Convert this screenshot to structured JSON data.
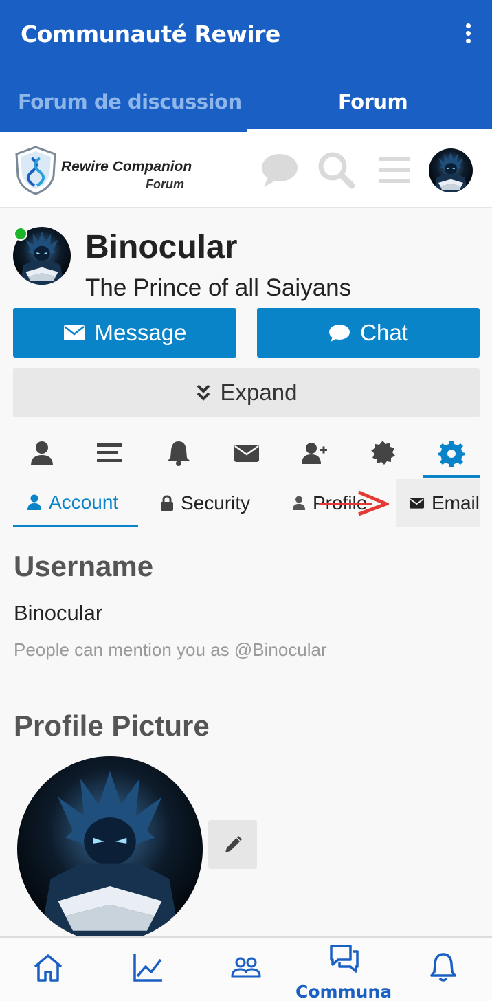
{
  "app_bar": {
    "title": "Communauté Rewire"
  },
  "tabs": [
    {
      "label": "Forum de discussion",
      "active": false
    },
    {
      "label": "Forum",
      "active": true
    }
  ],
  "site_header": {
    "logo_name": "Rewire Companion",
    "logo_sub": "Forum",
    "icons": [
      "chat-bubble-icon",
      "search-icon",
      "menu-icon",
      "avatar"
    ]
  },
  "profile": {
    "name": "Binocular",
    "title": "The Prince of all Saiyans",
    "online": true
  },
  "actions": {
    "message_label": "Message",
    "chat_label": "Chat",
    "expand_label": "Expand"
  },
  "icon_tabs": [
    "user-icon",
    "list-icon",
    "bell-icon",
    "envelope-icon",
    "add-user-icon",
    "badge-icon",
    "gear-icon"
  ],
  "sub_tabs": {
    "account": "Account",
    "security": "Security",
    "profile": "Profile",
    "email": "Email"
  },
  "account": {
    "username_heading": "Username",
    "username_value": "Binocular",
    "mention_note": "People can mention you as @Binocular",
    "picture_heading": "Profile Picture"
  },
  "bottom_nav": {
    "items": [
      "home-icon",
      "chart-icon",
      "members-icon",
      "communa-icon",
      "bell-icon"
    ],
    "active_label": "Communa"
  },
  "colors": {
    "primary": "#1a5fc4",
    "accent": "#0a84c8",
    "online": "#1fb52a",
    "annotation_arrow": "#e53935"
  }
}
